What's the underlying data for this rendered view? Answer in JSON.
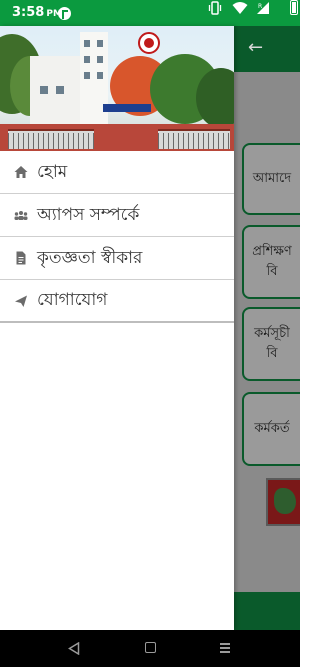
{
  "status_bar": {
    "time": "3:58",
    "ampm": "PM",
    "battery_level": 1.0,
    "icons": [
      "app-notification-icon",
      "vibrate-icon",
      "wifi-icon",
      "signal-icon",
      "battery-icon"
    ]
  },
  "drawer": {
    "header_image": "office-building-photo",
    "menu": [
      {
        "label": "হোম",
        "icon": "home-icon"
      },
      {
        "label": "অ্যাপস সম্পর্কে",
        "icon": "people-icon"
      },
      {
        "label": "কৃতজ্ঞতা স্বীকার",
        "icon": "document-icon"
      },
      {
        "label": "যোগাযোগ",
        "icon": "send-icon"
      }
    ]
  },
  "background_app": {
    "back_icon": "back-arrow-icon",
    "cards": [
      {
        "lines": [
          "আমাদে"
        ]
      },
      {
        "lines": [
          "প্রশিক্ষণ",
          "বি"
        ]
      },
      {
        "lines": [
          "কর্মসূচী",
          "বি"
        ]
      },
      {
        "lines": [
          "কর্মকর্ত"
        ]
      }
    ]
  },
  "colors": {
    "status_bar": "#0b9a3f",
    "toolbar": "#0a5a2b",
    "scrim": "#8a8a8a",
    "menu_text": "#333333",
    "menu_icon": "#6b6b6b"
  },
  "nav_bar": {
    "icons": [
      "nav-back-icon",
      "nav-home-icon",
      "nav-recents-icon"
    ]
  }
}
